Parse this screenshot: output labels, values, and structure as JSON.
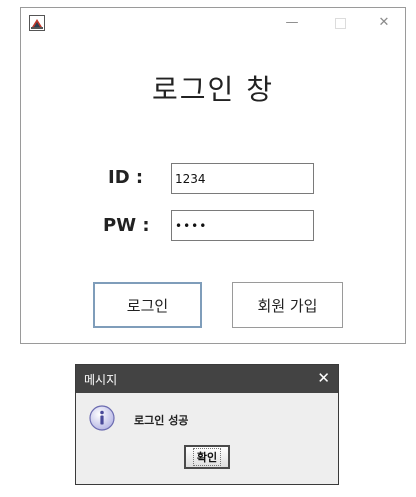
{
  "login_window": {
    "title": "로그인 창",
    "id_label": "ID :",
    "id_value": "1234",
    "pw_label": "PW :",
    "pw_value": "••••",
    "login_button": "로그인",
    "signup_button": "회원 가입",
    "controls": {
      "minimize": "—",
      "close": "✕"
    },
    "icon": "java-app-icon"
  },
  "message_dialog": {
    "title": "메시지",
    "close": "✕",
    "message": "로그인 성공",
    "ok_button": "확인",
    "icon": "info-icon"
  }
}
